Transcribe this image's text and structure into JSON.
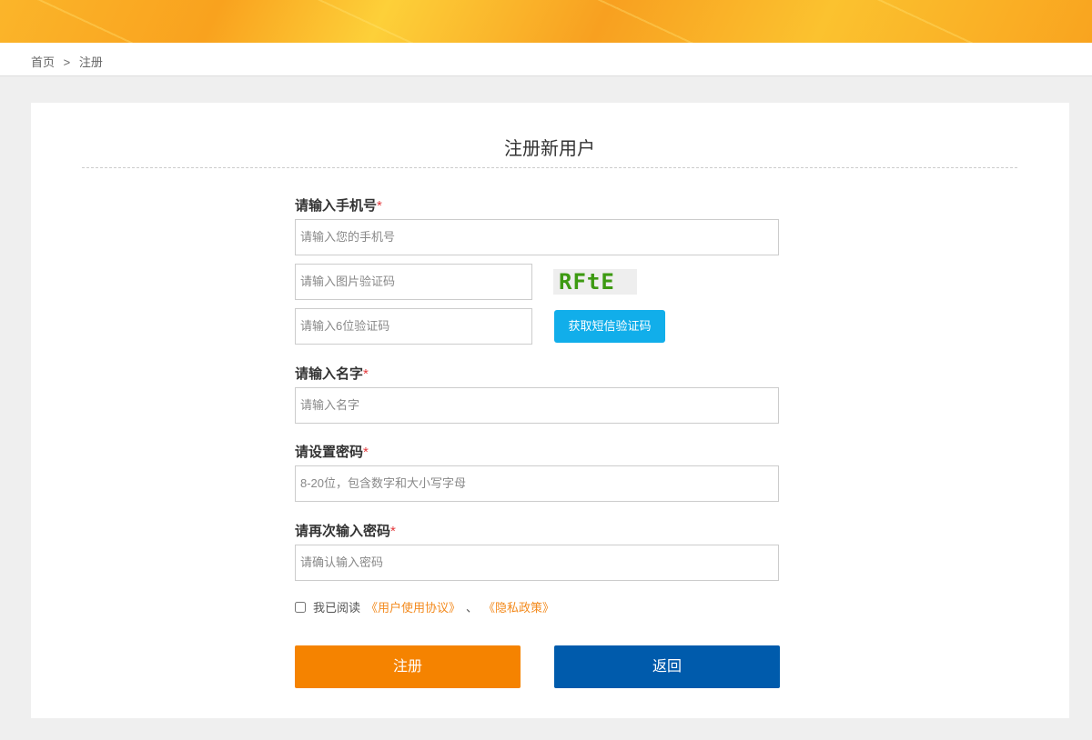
{
  "breadcrumb": {
    "home": "首页",
    "sep": ">",
    "current": "注册"
  },
  "form": {
    "title": "注册新用户",
    "phone_label": "请输入手机号",
    "required": "*",
    "phone_placeholder": "请输入您的手机号",
    "captcha_placeholder": "请输入图片验证码",
    "captcha_text": "RFtE",
    "sms_placeholder": "请输入6位验证码",
    "sms_button": "获取短信验证码",
    "name_label": "请输入名字",
    "name_placeholder": "请输入名字",
    "password_label": "请设置密码",
    "password_placeholder": "8-20位，包含数字和大小写字母",
    "confirm_label": "请再次输入密码",
    "confirm_placeholder": "请确认输入密码",
    "agree_text": "我已阅读",
    "agreement_link": "《用户使用协议》",
    "agree_sep": "、",
    "privacy_link": "《隐私政策》",
    "register_button": "注册",
    "back_button": "返回"
  },
  "colors": {
    "register": "#f58300",
    "back": "#005bac",
    "sms": "#11aeea",
    "link": "#f38a1d"
  }
}
